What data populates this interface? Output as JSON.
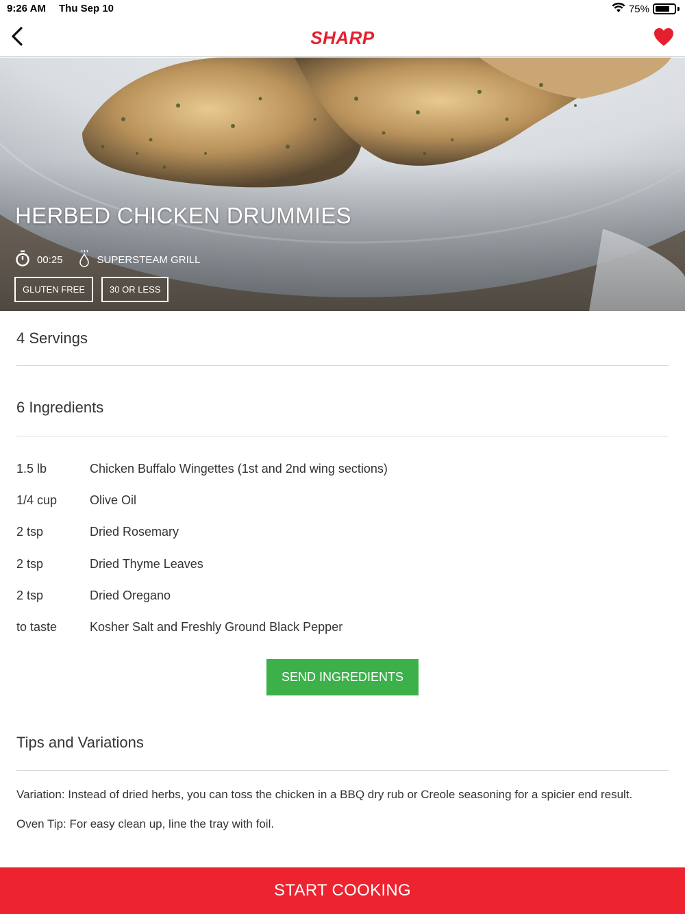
{
  "status_bar": {
    "time": "9:26 AM",
    "date": "Thu Sep 10",
    "battery_percent": "75%",
    "battery_level": 0.75,
    "icons": [
      "wifi-icon",
      "battery-icon"
    ]
  },
  "nav": {
    "back_icon": "chevron-left-icon",
    "logo_text": "SHARP",
    "favorite_icon": "heart-icon",
    "favorite_color": "#e5202e"
  },
  "recipe": {
    "title": "HERBED CHICKEN DRUMMIES",
    "time": "00:25",
    "time_icon": "stopwatch-icon",
    "cook_mode": "SUPERSTEAM GRILL",
    "cook_mode_icon": "steam-drop-icon",
    "tags": [
      "GLUTEN FREE",
      "30 OR LESS"
    ]
  },
  "servings": "4 Servings",
  "ingredients_heading": "6 Ingredients",
  "ingredients": [
    {
      "qty": "1.5 lb",
      "name": "Chicken Buffalo Wingettes (1st and 2nd wing sections)"
    },
    {
      "qty": "1/4 cup",
      "name": "Olive Oil"
    },
    {
      "qty": "2 tsp",
      "name": "Dried Rosemary"
    },
    {
      "qty": "2 tsp",
      "name": "Dried Thyme Leaves"
    },
    {
      "qty": "2 tsp",
      "name": "Dried Oregano"
    },
    {
      "qty": "to taste",
      "name": "Kosher Salt and Freshly Ground Black Pepper"
    }
  ],
  "send_button": "SEND INGREDIENTS",
  "tips": {
    "heading": "Tips and Variations",
    "paragraphs": [
      "Variation: Instead of dried herbs, you can toss the chicken in a BBQ dry rub or Creole seasoning for a spicier end result.",
      "Oven Tip: For easy clean up, line the tray with foil."
    ]
  },
  "start_button": "START COOKING",
  "colors": {
    "brand_red": "#e5202e",
    "start_button": "#ee2330",
    "send_button": "#3cb14a"
  }
}
